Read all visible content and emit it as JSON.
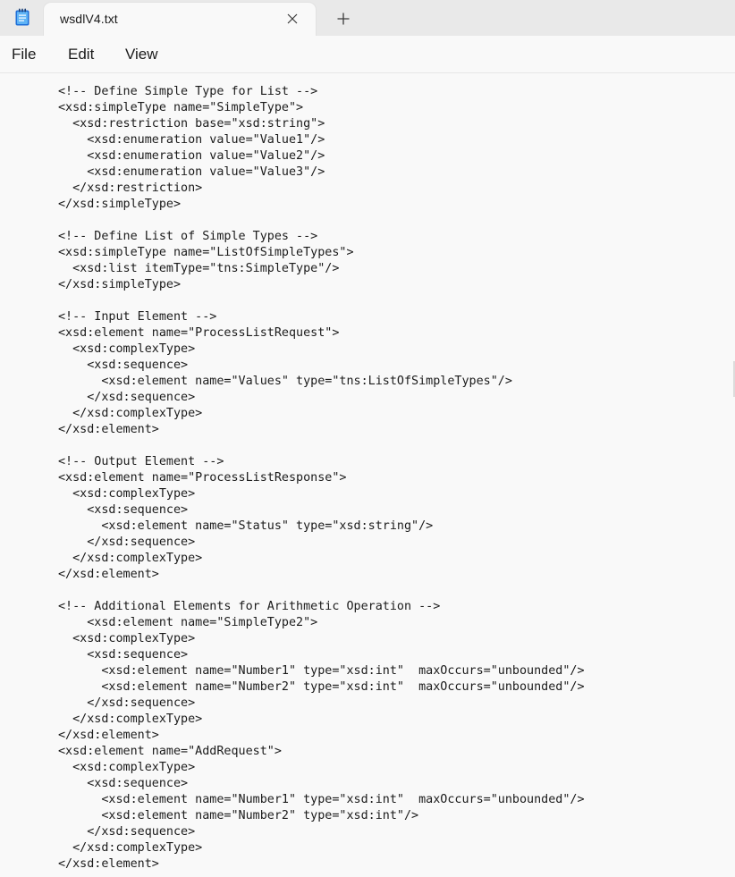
{
  "window": {
    "tab_title": "wsdlV4.txt",
    "app_icon": "notepad-icon",
    "close_icon": "close-icon",
    "new_tab_icon": "plus-icon"
  },
  "menu": {
    "file": "File",
    "edit": "Edit",
    "view": "View"
  },
  "editor": {
    "lines": [
      "<!-- Define Simple Type for List -->",
      "<xsd:simpleType name=\"SimpleType\">",
      "  <xsd:restriction base=\"xsd:string\">",
      "    <xsd:enumeration value=\"Value1\"/>",
      "    <xsd:enumeration value=\"Value2\"/>",
      "    <xsd:enumeration value=\"Value3\"/>",
      "  </xsd:restriction>",
      "</xsd:simpleType>",
      "",
      "<!-- Define List of Simple Types -->",
      "<xsd:simpleType name=\"ListOfSimpleTypes\">",
      "  <xsd:list itemType=\"tns:SimpleType\"/>",
      "</xsd:simpleType>",
      "",
      "<!-- Input Element -->",
      "<xsd:element name=\"ProcessListRequest\">",
      "  <xsd:complexType>",
      "    <xsd:sequence>",
      "      <xsd:element name=\"Values\" type=\"tns:ListOfSimpleTypes\"/>",
      "    </xsd:sequence>",
      "  </xsd:complexType>",
      "</xsd:element>",
      "",
      "<!-- Output Element -->",
      "<xsd:element name=\"ProcessListResponse\">",
      "  <xsd:complexType>",
      "    <xsd:sequence>",
      "      <xsd:element name=\"Status\" type=\"xsd:string\"/>",
      "    </xsd:sequence>",
      "  </xsd:complexType>",
      "</xsd:element>",
      "",
      "<!-- Additional Elements for Arithmetic Operation -->",
      "    <xsd:element name=\"SimpleType2\">",
      "  <xsd:complexType>",
      "    <xsd:sequence>",
      "      <xsd:element name=\"Number1\" type=\"xsd:int\"  maxOccurs=\"unbounded\"/>",
      "      <xsd:element name=\"Number2\" type=\"xsd:int\"  maxOccurs=\"unbounded\"/>",
      "    </xsd:sequence>",
      "  </xsd:complexType>",
      "</xsd:element>",
      "<xsd:element name=\"AddRequest\">",
      "  <xsd:complexType>",
      "    <xsd:sequence>",
      "      <xsd:element name=\"Number1\" type=\"xsd:int\"  maxOccurs=\"unbounded\"/>",
      "      <xsd:element name=\"Number2\" type=\"xsd:int\"/>",
      "    </xsd:sequence>",
      "  </xsd:complexType>",
      "</xsd:element>"
    ]
  }
}
